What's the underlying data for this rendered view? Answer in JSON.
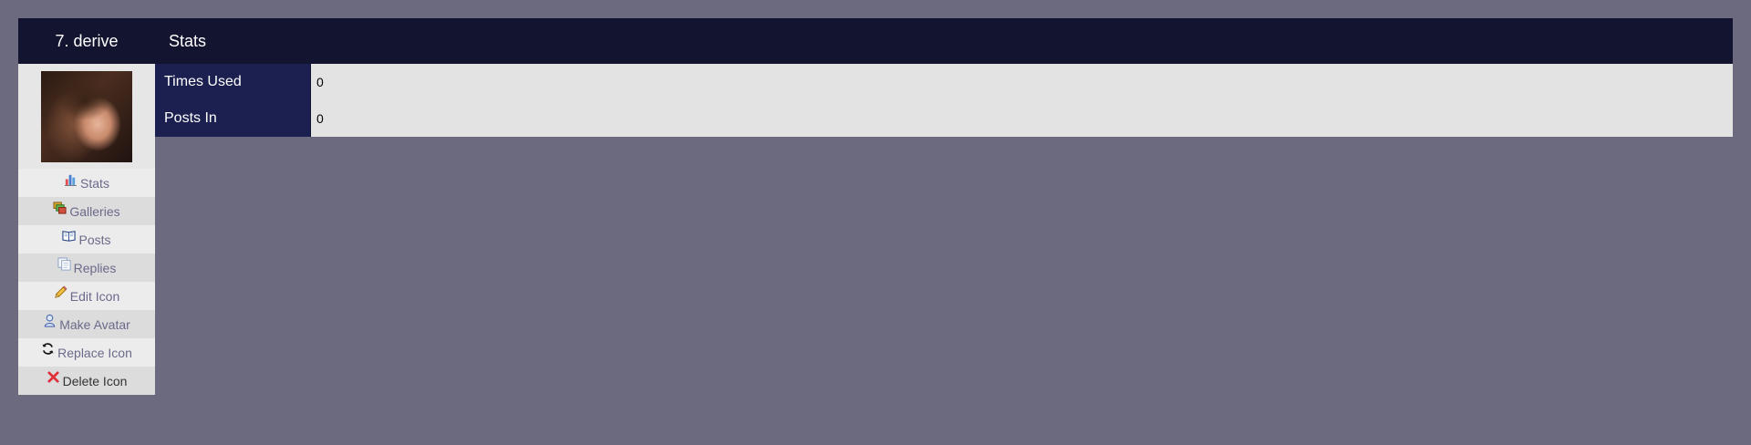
{
  "header": {
    "icon_name": "7. derive",
    "section_title": "Stats"
  },
  "sidebar": {
    "avatar_alt": "icon image",
    "items": [
      {
        "label": "Stats",
        "icon": "bar-chart-icon"
      },
      {
        "label": "Galleries",
        "icon": "galleries-icon"
      },
      {
        "label": "Posts",
        "icon": "book-icon"
      },
      {
        "label": "Replies",
        "icon": "replies-icon"
      },
      {
        "label": "Edit Icon",
        "icon": "pencil-icon"
      },
      {
        "label": "Make Avatar",
        "icon": "user-icon"
      },
      {
        "label": "Replace Icon",
        "icon": "refresh-icon"
      },
      {
        "label": "Delete Icon",
        "icon": "delete-x-icon"
      }
    ]
  },
  "stats": {
    "rows": [
      {
        "label": "Times Used",
        "value": "0"
      },
      {
        "label": "Posts In",
        "value": "0"
      }
    ]
  },
  "colors": {
    "page_bg": "#6c6a7e",
    "header_bg": "#131430",
    "label_bg": "#1b2050",
    "link_color": "#6b6a8a",
    "delete_red": "#e0303a"
  }
}
